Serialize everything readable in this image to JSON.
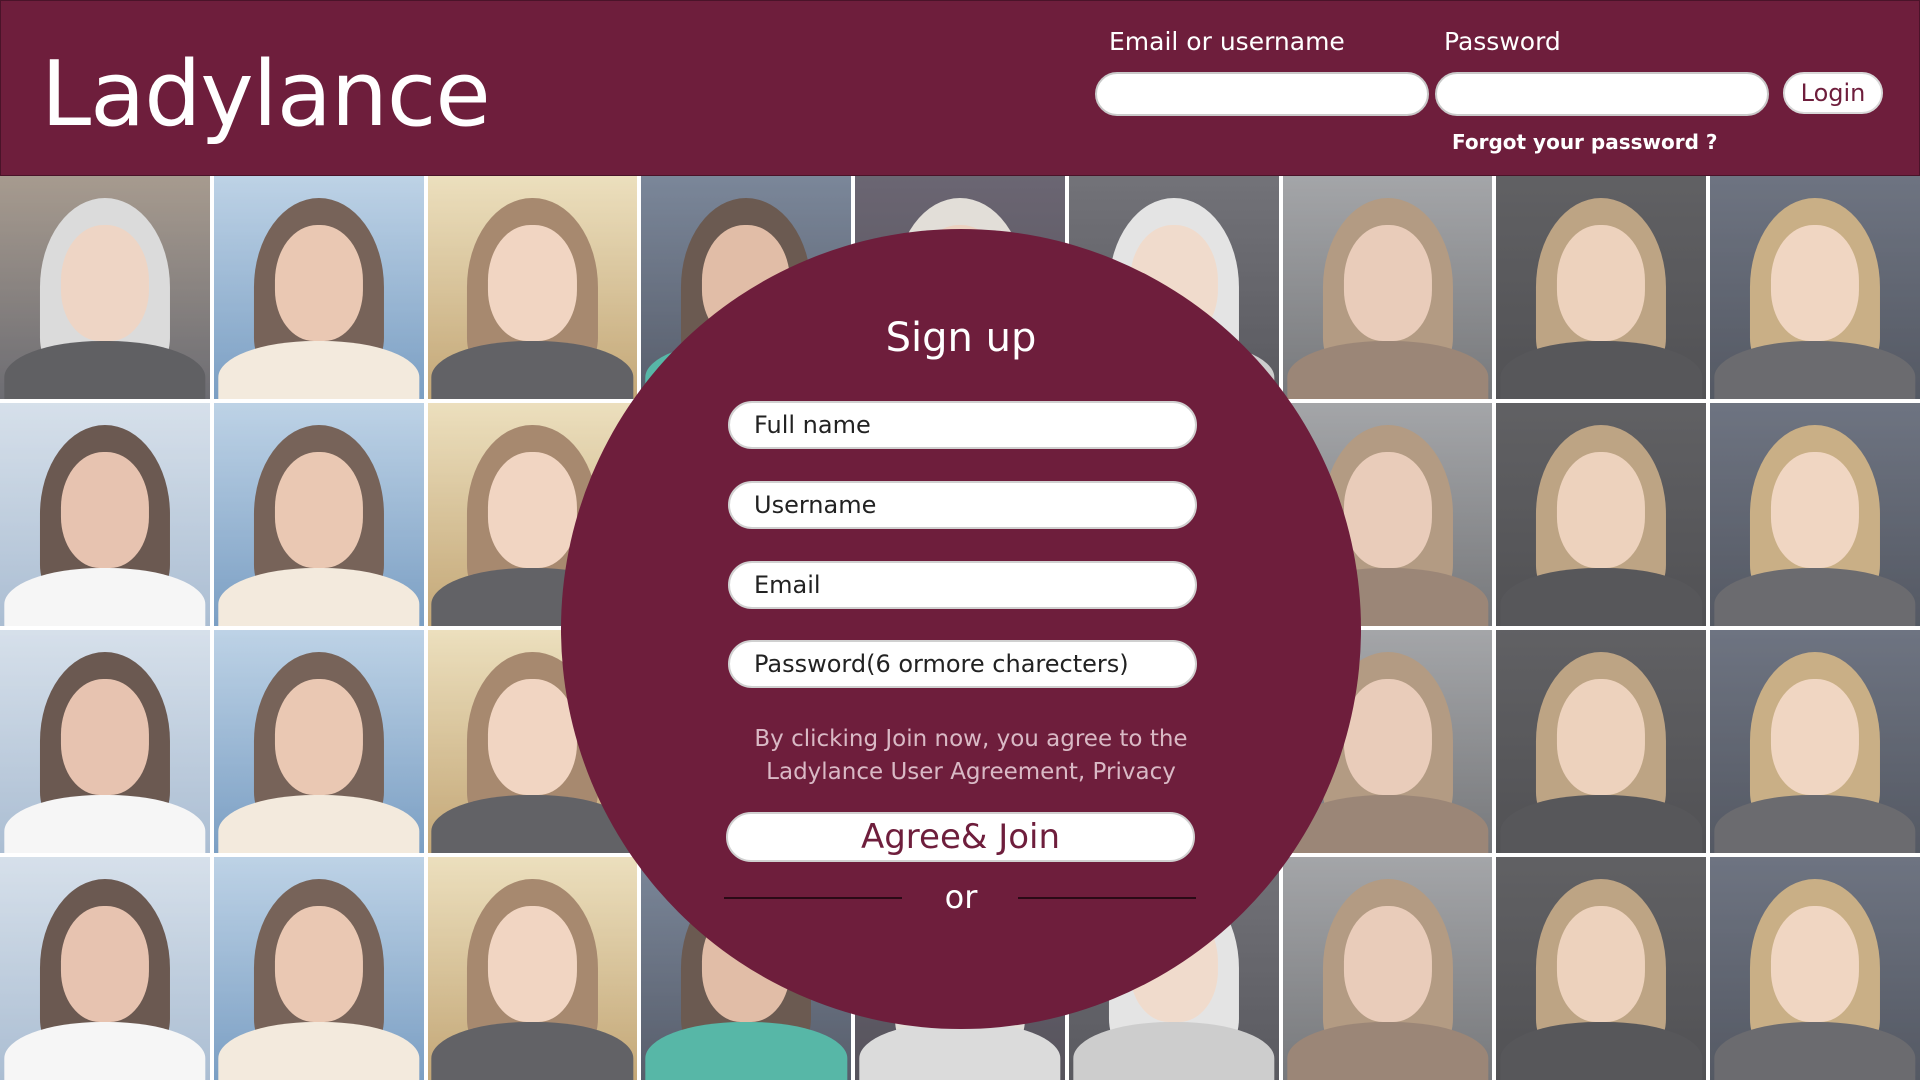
{
  "header": {
    "brand": "Ladylance",
    "email_label": "Email or username",
    "password_label": "Password",
    "login_label": "Login",
    "forgot_label": "Forgot your password ?"
  },
  "signup": {
    "title": "Sign up",
    "fullname_placeholder": "Full name",
    "username_placeholder": "Username",
    "email_placeholder": "Email",
    "password_placeholder": "Password(6 ormore charecters)",
    "agreement_text": "By clicking Join now, you agree to the Ladylance User Agreement, Privacy",
    "join_label": "Agree& Join",
    "or_label": "or"
  },
  "colors": {
    "brand": "#6e1e3c",
    "text_light": "#ffffff",
    "agreement_text": "#d9b9c5"
  }
}
